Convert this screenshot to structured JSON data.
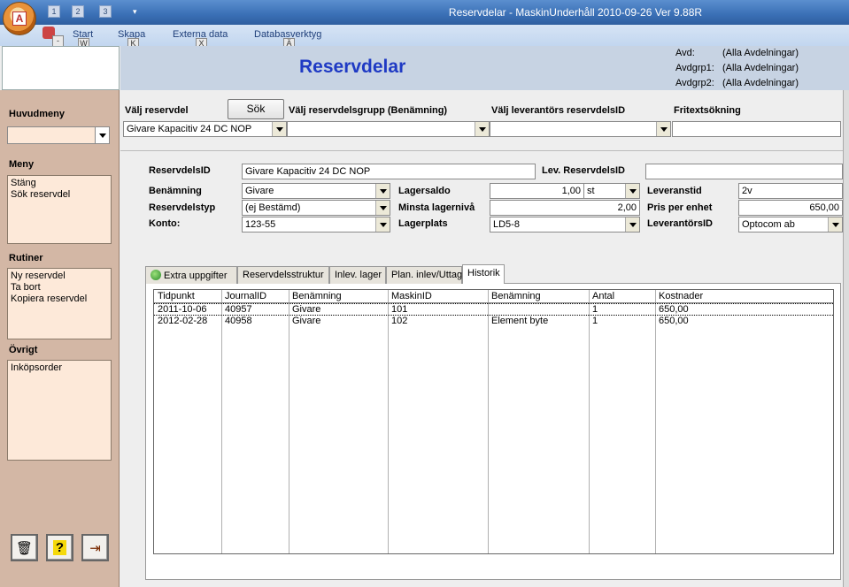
{
  "window": {
    "title": "Reservdelar - MaskinUnderhåll 2010-09-26  Ver 9.88R"
  },
  "quick_access": {
    "keytips": [
      "1",
      "2",
      "3"
    ],
    "office_keytip": "A"
  },
  "ribbon": {
    "tabs": [
      {
        "label": "Start",
        "keytip": "W"
      },
      {
        "label": "Skapa",
        "keytip": "K"
      },
      {
        "label": "Externa data",
        "keytip": "X"
      },
      {
        "label": "Databasverktyg",
        "keytip": "Ä"
      }
    ],
    "misc_keytip": "-"
  },
  "header": {
    "title": "Reservdelar",
    "avd": [
      {
        "label": "Avd:",
        "value": "(Alla Avdelningar)"
      },
      {
        "label": "Avdgrp1:",
        "value": "(Alla Avdelningar)"
      },
      {
        "label": "Avdgrp2:",
        "value": "(Alla Avdelningar)"
      }
    ]
  },
  "sidebar": {
    "huvudmeny_label": "Huvudmeny",
    "huvudmeny_value": "",
    "meny_label": "Meny",
    "meny_items": [
      "Stäng",
      "Sök reservdel"
    ],
    "rutiner_label": "Rutiner",
    "rutiner_items": [
      "Ny reservdel",
      "Ta bort",
      "Kopiera reservdel"
    ],
    "ovrigt_label": "Övrigt",
    "ovrigt_items": [
      "Inköpsorder"
    ],
    "buttons": {
      "delete_icon": "trash-icon",
      "help_icon": "question-icon",
      "exit_icon": "exit-icon"
    }
  },
  "search": {
    "valj_reservdel_label": "Välj reservdel",
    "sok_button": "Sök",
    "valj_reservdel_value": "Givare Kapacitiv 24 DC NOP",
    "grupp_label": "Välj reservdelsgrupp (Benämning)",
    "grupp_value": "",
    "leverantor_label": "Välj leverantörs reservdelsID",
    "leverantor_value": "",
    "fritext_label": "Fritextsökning",
    "fritext_value": ""
  },
  "form": {
    "reservdelsid_label": "ReservdelsID",
    "reservdelsid_value": "Givare Kapacitiv 24 DC NOP",
    "lev_reservdelsid_label": "Lev. ReservdelsID",
    "lev_reservdelsid_value": "",
    "benamning_label": "Benämning",
    "benamning_value": "Givare",
    "reservdelstyp_label": "Reservdelstyp",
    "reservdelstyp_value": "(ej Bestämd)",
    "konto_label": "Konto:",
    "konto_value": "123-55",
    "lagersaldo_label": "Lagersaldo",
    "lagersaldo_value": "1,00",
    "lagersaldo_unit": "st",
    "minsta_label": "Minsta lagernivå",
    "minsta_value": "2,00",
    "lagerplats_label": "Lagerplats",
    "lagerplats_value": "LD5-8",
    "leveranstid_label": "Leveranstid",
    "leveranstid_value": "2v",
    "pris_label": "Pris per enhet",
    "pris_value": "650,00",
    "leverantorsid_label": "LeverantörsID",
    "leverantorsid_value": "Optocom ab"
  },
  "tabs": [
    "Extra uppgifter",
    "Reservdelsstruktur",
    "Inlev. lager",
    "Plan. inlev/Uttag",
    "Historik"
  ],
  "active_tab": "Historik",
  "history": {
    "columns": [
      "Tidpunkt",
      "JournalID",
      "Benämning",
      "MaskinID",
      "Benämning",
      "Antal",
      "Kostnader"
    ],
    "rows": [
      [
        "2011-10-06",
        "40957",
        "Givare",
        "101",
        "",
        "1",
        "650,00"
      ],
      [
        "2012-02-28",
        "40958",
        "Givare",
        "102",
        "Element byte",
        "1",
        "650,00"
      ]
    ]
  }
}
